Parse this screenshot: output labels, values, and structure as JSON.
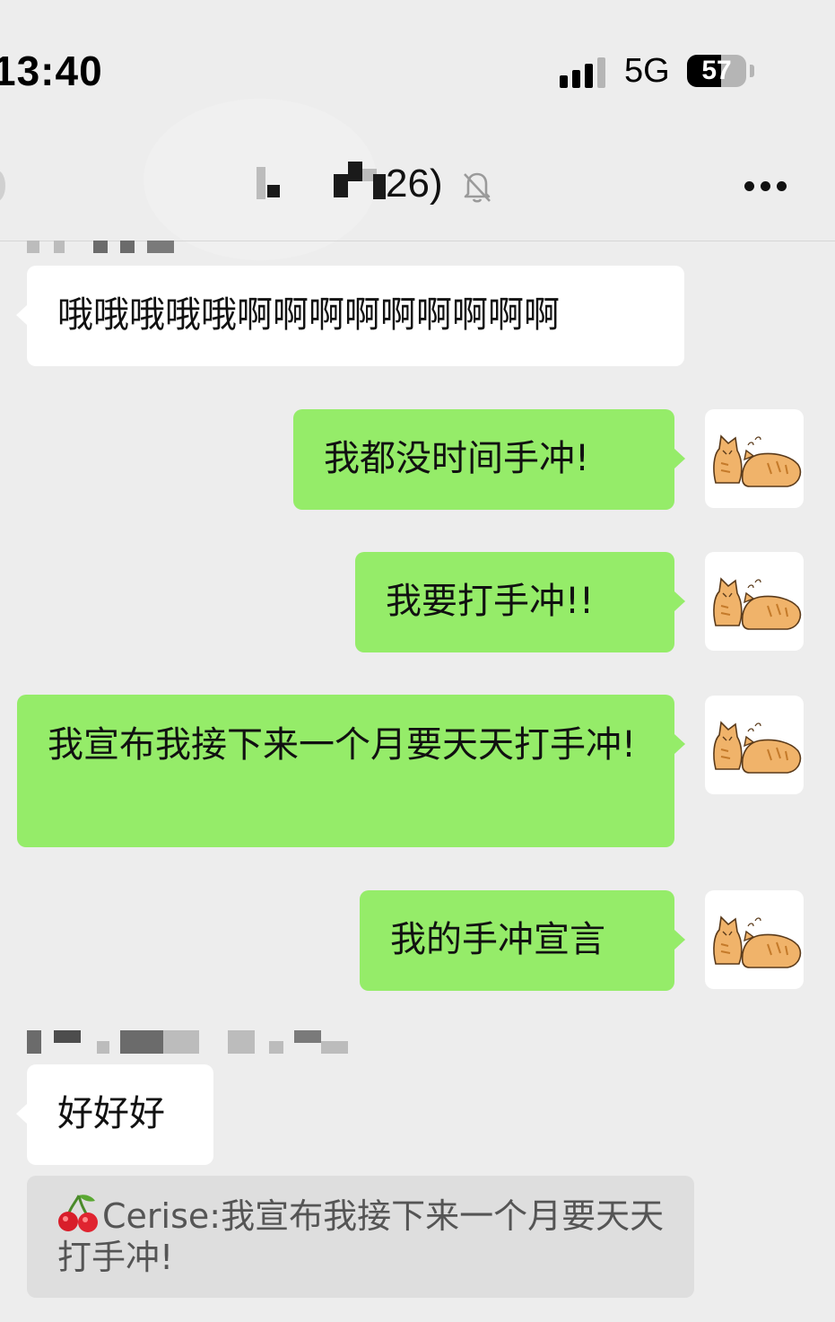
{
  "status_bar": {
    "time": "13:40",
    "network": "5G",
    "battery": "57",
    "battery_level": 0.57
  },
  "header": {
    "title_visible": "26)",
    "muted_icon": "bell-slash-icon",
    "more_icon": "more-icon"
  },
  "messages": [
    {
      "side": "left",
      "text": "哦哦哦哦哦啊啊啊啊啊啊啊啊啊"
    },
    {
      "side": "right",
      "text": "我都没时间手冲!",
      "avatar": "cats-icon"
    },
    {
      "side": "right",
      "text": "我要打手冲!!",
      "avatar": "cats-icon"
    },
    {
      "side": "right",
      "text": "我宣布我接下来一个月要天天打手冲!",
      "avatar": "cats-icon"
    },
    {
      "side": "right",
      "text": "我的手冲宣言",
      "avatar": "cats-icon"
    },
    {
      "side": "left",
      "text": "好好好"
    }
  ],
  "quote": {
    "icon": "cherry-icon",
    "author": "Cerise:",
    "text": "我宣布我接下来一个月要天天打手冲!"
  },
  "colors": {
    "background": "#ededed",
    "sent_bubble": "#95ec69",
    "received_bubble": "#ffffff",
    "quote_bg": "#dedede"
  }
}
